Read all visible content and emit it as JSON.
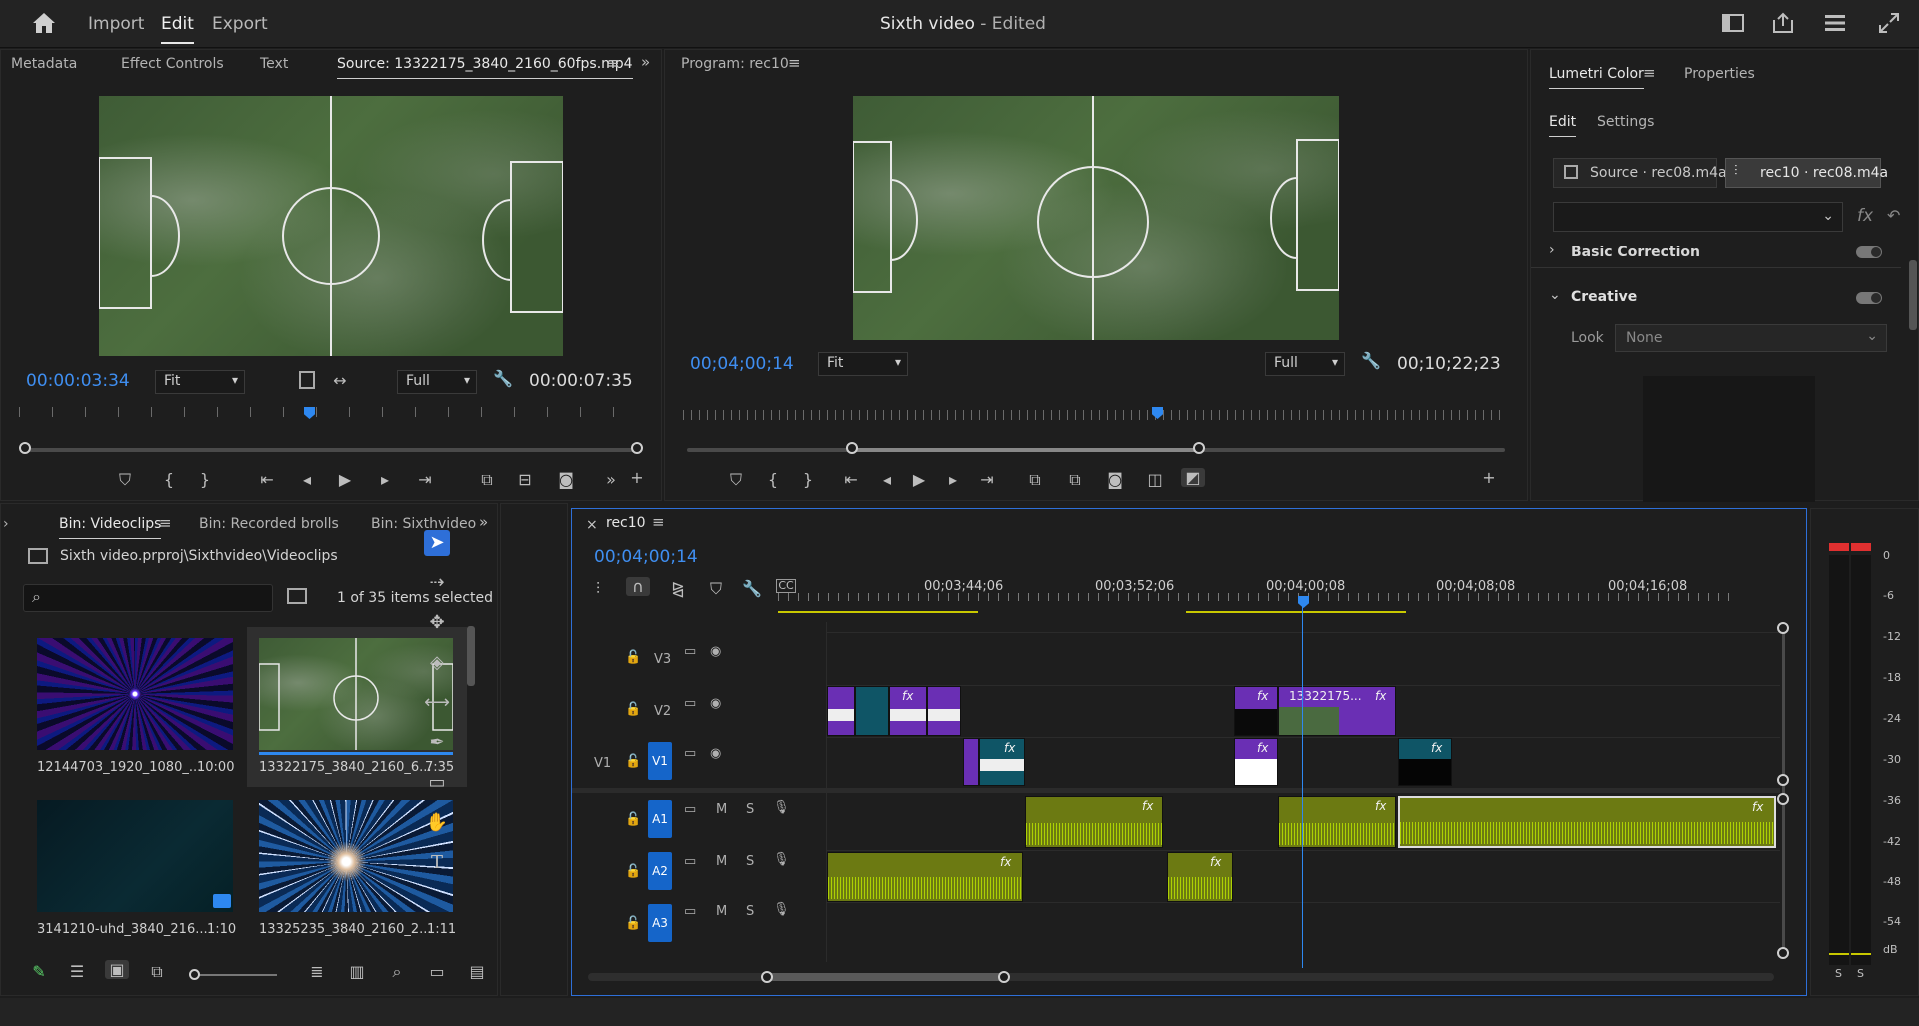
{
  "app": {
    "menu": [
      "Import",
      "Edit",
      "Export"
    ],
    "title": "Sixth video",
    "title_status": " - Edited",
    "icons": [
      "home-icon",
      "workspace-icon",
      "share-icon",
      "quick-export-icon",
      "fullscreen-icon"
    ]
  },
  "source_panel": {
    "tabs": [
      "Metadata",
      "Effect Controls",
      "Text",
      "Source: 13322175_3840_2160_60fps.mp4"
    ],
    "timecode_current": "00:00:03:34",
    "fit": "Fit",
    "quality": "Full",
    "duration": "00:00:07:35"
  },
  "program_panel": {
    "title": "Program: rec10",
    "timecode_current": "00;04;00;14",
    "fit": "Fit",
    "quality": "Full",
    "duration": "00;10;22;23"
  },
  "lumetri": {
    "tabs": [
      "Lumetri Color",
      "Properties"
    ],
    "subtabs": [
      "Edit",
      "Settings"
    ],
    "source_btn": "Source · rec08.m4a",
    "target_btn": "rec10 · rec08.m4a",
    "section_basic": "Basic Correction",
    "section_creative": "Creative",
    "look_label": "Look",
    "look_value": "None"
  },
  "project": {
    "tabs": [
      "Bin: Videoclips",
      "Bin: Recorded brolls",
      "Bin: Sixthvideo"
    ],
    "path": "Sixth video.prproj\\Sixthvideo\\Videoclips",
    "search_placeholder": "",
    "selection_info": "1 of 35 items selected",
    "items": [
      {
        "name": "12144703_1920_1080_...",
        "duration": "10:00"
      },
      {
        "name": "13322175_3840_2160_6...",
        "duration": "7:35"
      },
      {
        "name": "3141210-uhd_3840_216...",
        "duration": "1:10"
      },
      {
        "name": "13325235_3840_2160_2...",
        "duration": "1:11"
      }
    ]
  },
  "timeline": {
    "sequence": "rec10",
    "close": "×",
    "timecode": "00;04;00;14",
    "ruler": [
      "00;03;44;06",
      "00;03;52;06",
      "00;04;00;08",
      "00;04;08;08",
      "00;04;16;08"
    ],
    "tracks": {
      "video": [
        {
          "name": "V3"
        },
        {
          "name": "V2"
        },
        {
          "name": "V1",
          "source": "V1"
        }
      ],
      "audio": [
        {
          "name": "A1",
          "m": "M",
          "s": "S"
        },
        {
          "name": "A2",
          "m": "M",
          "s": "S"
        },
        {
          "name": "A3",
          "m": "M",
          "s": "S"
        }
      ]
    },
    "clip_label": "13322175...",
    "fx": "fx"
  },
  "meter": {
    "labels": [
      "0",
      "-6",
      "-12",
      "-18",
      "-24",
      "-30",
      "-36",
      "-42",
      "-48",
      "-54",
      "dB"
    ],
    "solo": [
      "S",
      "S"
    ]
  },
  "colors": {
    "accent": "#2e88f0",
    "video_clip": "#6a2fb4",
    "teal_clip": "#0f5566",
    "audio_clip": "#6c7a12"
  }
}
